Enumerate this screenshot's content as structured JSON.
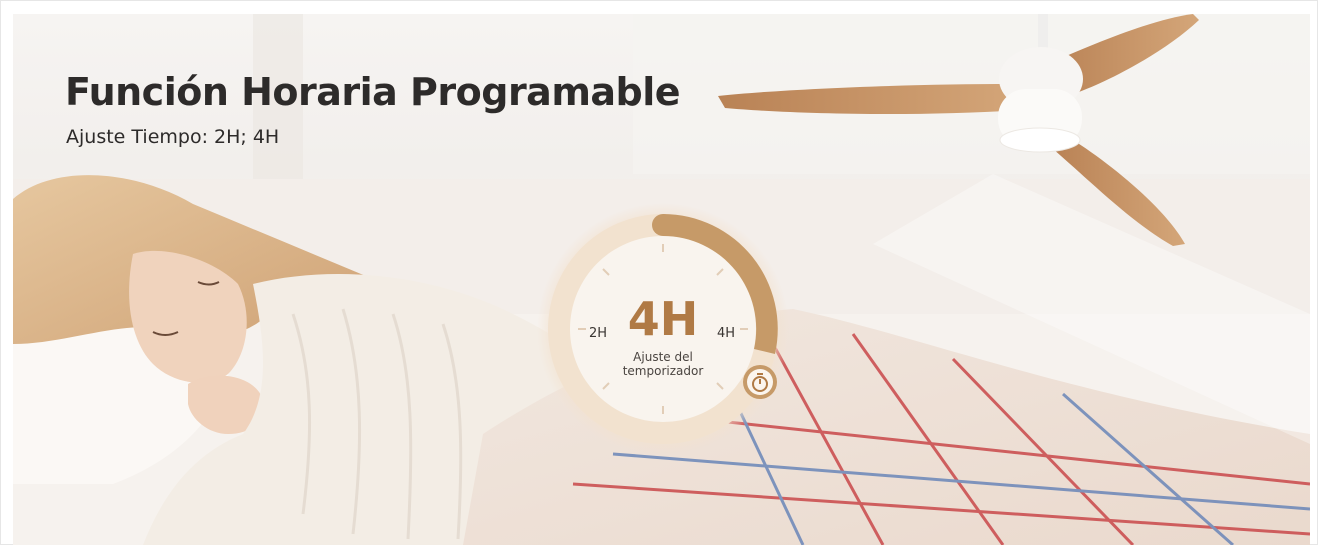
{
  "banner": {
    "title": "Función Horaria Programable",
    "subtitle": "Ajuste Tiempo: 2H; 4H"
  },
  "timer": {
    "value": "4H",
    "min_label": "2H",
    "max_label": "4H",
    "caption_line1": "Ajuste del",
    "caption_line2": "temporizador",
    "icon": "stopwatch-icon",
    "accent_color": "#b07a45",
    "ring_color": "#c69a68"
  },
  "product": {
    "icon": "ceiling-fan-icon",
    "blade_color": "#c8956a",
    "body_color": "#f7f5f3"
  }
}
